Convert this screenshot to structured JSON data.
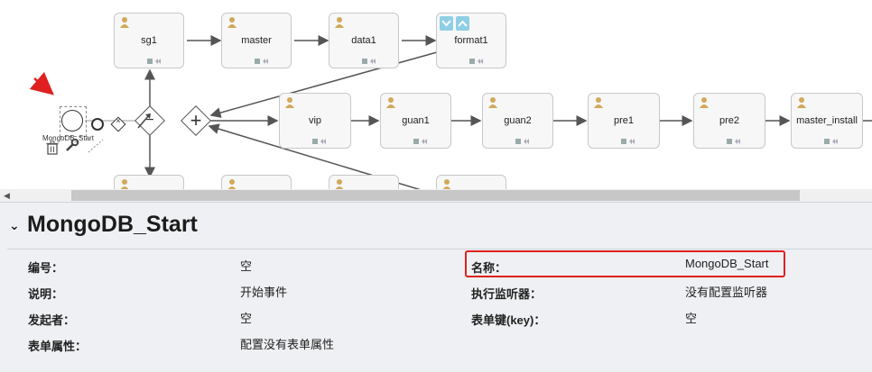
{
  "diagram": {
    "tasks_row1": [
      "sg1",
      "master",
      "data1",
      "format1"
    ],
    "tasks_row2": [
      "vip",
      "guan1",
      "guan2",
      "pre1",
      "pre2",
      "master_install"
    ],
    "selected_event_label": "MongoDB_Start",
    "colors": {
      "task_bg": "#f7f7f7",
      "task_border": "#c8c8c8",
      "edge": "#555555",
      "annotation_arrow": "#e02020"
    }
  },
  "panel": {
    "title": "MongoDB_Start",
    "fields_left": [
      {
        "label": "编号：",
        "value": "空"
      },
      {
        "label": "说明：",
        "value": "开始事件"
      },
      {
        "label": "发起者：",
        "value": "空"
      },
      {
        "label": "表单属性：",
        "value": "配置没有表单属性"
      }
    ],
    "fields_right": [
      {
        "label": "名称：",
        "value": "MongoDB_Start"
      },
      {
        "label": "执行监听器：",
        "value": "没有配置监听器"
      },
      {
        "label": "表单键(key)：",
        "value": "空"
      }
    ],
    "highlight_color": "#e02020"
  }
}
